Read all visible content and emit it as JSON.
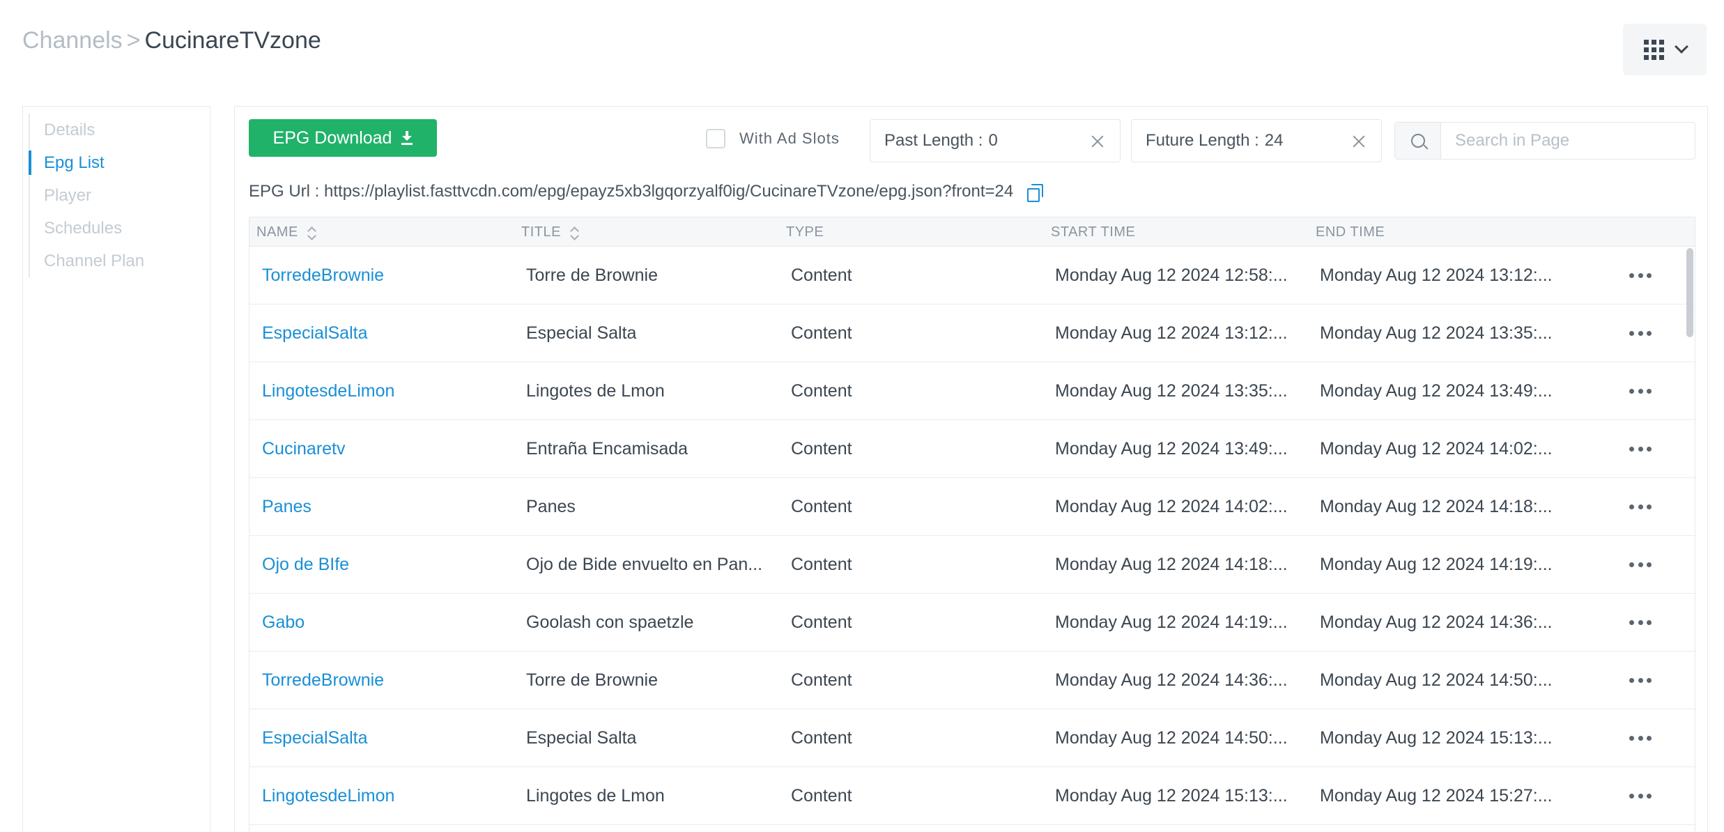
{
  "breadcrumb": {
    "parent": "Channels",
    "separator": ">",
    "current": "CucinareTVzone"
  },
  "sidebar": {
    "items": [
      {
        "label": "Details",
        "active": false
      },
      {
        "label": "Epg List",
        "active": true
      },
      {
        "label": "Player",
        "active": false
      },
      {
        "label": "Schedules",
        "active": false
      },
      {
        "label": "Channel Plan",
        "active": false
      }
    ]
  },
  "toolbar": {
    "download_label": "EPG Download",
    "ad_slots_label": "With Ad Slots",
    "ad_slots_checked": false,
    "past_length_label": "Past Length :",
    "past_length_value": "0",
    "future_length_label": "Future Length :",
    "future_length_value": "24",
    "search_placeholder": "Search in Page"
  },
  "epg_url": {
    "label": "EPG Url :",
    "value": "https://playlist.fasttvcdn.com/epg/epayz5xb3lgqorzyalf0ig/CucinareTVzone/epg.json?front=24"
  },
  "table": {
    "columns": [
      "NAME",
      "TITLE",
      "TYPE",
      "START TIME",
      "END TIME"
    ],
    "rows": [
      {
        "name": "TorredeBrownie",
        "title": "Torre de Brownie",
        "type": "Content",
        "start": "Monday Aug 12 2024 12:58:...",
        "end": "Monday Aug 12 2024 13:12:..."
      },
      {
        "name": "EspecialSalta",
        "title": "Especial Salta",
        "type": "Content",
        "start": "Monday Aug 12 2024 13:12:...",
        "end": "Monday Aug 12 2024 13:35:..."
      },
      {
        "name": "LingotesdeLimon",
        "title": "Lingotes de Lmon",
        "type": "Content",
        "start": "Monday Aug 12 2024 13:35:...",
        "end": "Monday Aug 12 2024 13:49:..."
      },
      {
        "name": "Cucinaretv",
        "title": "Entraña Encamisada",
        "type": "Content",
        "start": "Monday Aug 12 2024 13:49:...",
        "end": "Monday Aug 12 2024 14:02:..."
      },
      {
        "name": "Panes",
        "title": "Panes",
        "type": "Content",
        "start": "Monday Aug 12 2024 14:02:...",
        "end": "Monday Aug 12 2024 14:18:..."
      },
      {
        "name": "Ojo de BIfe",
        "title": "Ojo de Bide envuelto en Pan...",
        "type": "Content",
        "start": "Monday Aug 12 2024 14:18:...",
        "end": "Monday Aug 12 2024 14:19:..."
      },
      {
        "name": "Gabo",
        "title": "Goolash con spaetzle",
        "type": "Content",
        "start": "Monday Aug 12 2024 14:19:...",
        "end": "Monday Aug 12 2024 14:36:..."
      },
      {
        "name": "TorredeBrownie",
        "title": "Torre de Brownie",
        "type": "Content",
        "start": "Monday Aug 12 2024 14:36:...",
        "end": "Monday Aug 12 2024 14:50:..."
      },
      {
        "name": "EspecialSalta",
        "title": "Especial Salta",
        "type": "Content",
        "start": "Monday Aug 12 2024 14:50:...",
        "end": "Monday Aug 12 2024 15:13:..."
      },
      {
        "name": "LingotesdeLimon",
        "title": "Lingotes de Lmon",
        "type": "Content",
        "start": "Monday Aug 12 2024 15:13:...",
        "end": "Monday Aug 12 2024 15:27:..."
      }
    ]
  },
  "icons": {
    "apps": "apps-grid-icon",
    "dropdown": "chevron-down-icon",
    "download": "download-icon",
    "clear": "close-icon",
    "search": "search-icon",
    "copy": "copy-icon",
    "sort": "sort-icon",
    "row_actions": "more-horizontal-icon"
  },
  "colors": {
    "primary": "#1a8fd6",
    "download_button": "#21b26a",
    "muted_text": "#b3bcc5"
  }
}
